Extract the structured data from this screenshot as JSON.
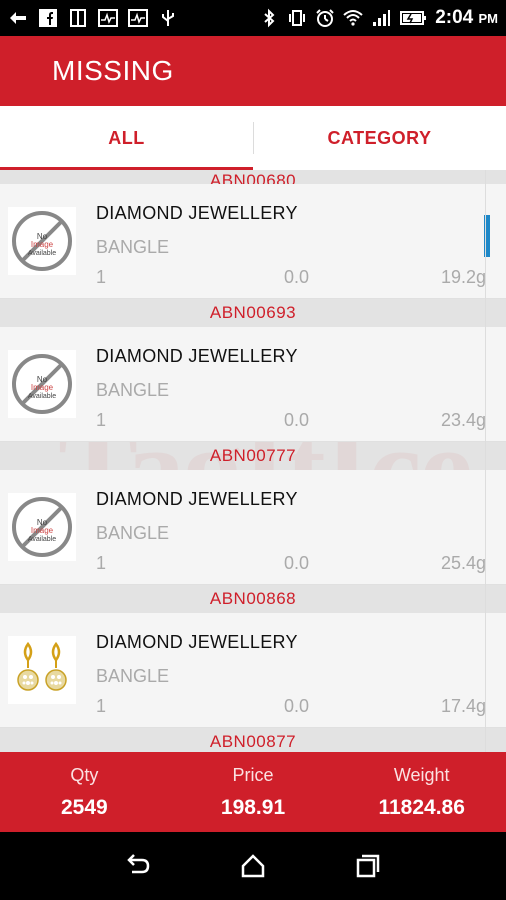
{
  "status_bar": {
    "time": "2:04",
    "ampm": "PM",
    "left_icons": [
      "back-arrow-icon",
      "facebook-icon",
      "tablet-icon",
      "activity-icon",
      "activity-icon",
      "usb-icon"
    ],
    "right_icons": [
      "bluetooth-icon",
      "vibrate-icon",
      "alarm-icon",
      "wifi-icon",
      "signal-icon",
      "battery-icon"
    ]
  },
  "app_bar": {
    "title": "MISSING"
  },
  "tabs": [
    {
      "label": "ALL",
      "active": true
    },
    {
      "label": "CATEGORY",
      "active": false
    }
  ],
  "watermark": "TagItIce",
  "list": {
    "partial_top_code": "ABN00680",
    "items": [
      {
        "name": "DIAMOND JEWELLERY",
        "category": "BANGLE",
        "qty": "1",
        "price": "0.0",
        "weight": "19.2g",
        "image": "no-image"
      },
      {
        "code": "ABN00693",
        "name": "DIAMOND JEWELLERY",
        "category": "BANGLE",
        "qty": "1",
        "price": "0.0",
        "weight": "23.4g",
        "image": "no-image"
      },
      {
        "code": "ABN00777",
        "name": "DIAMOND JEWELLERY",
        "category": "BANGLE",
        "qty": "1",
        "price": "0.0",
        "weight": "25.4g",
        "image": "no-image"
      },
      {
        "code": "ABN00868",
        "name": "DIAMOND JEWELLERY",
        "category": "BANGLE",
        "qty": "1",
        "price": "0.0",
        "weight": "17.4g",
        "image": "earrings"
      }
    ],
    "partial_bottom_code": "ABN00877"
  },
  "totals": {
    "qty_label": "Qty",
    "qty_value": "2549",
    "price_label": "Price",
    "price_value": "198.91",
    "weight_label": "Weight",
    "weight_value": "11824.86"
  },
  "nav_bar": {
    "icons": [
      "back-icon",
      "home-icon",
      "recents-icon"
    ]
  },
  "colors": {
    "accent": "#cf1f2a",
    "scroll": "#1e88c8"
  }
}
